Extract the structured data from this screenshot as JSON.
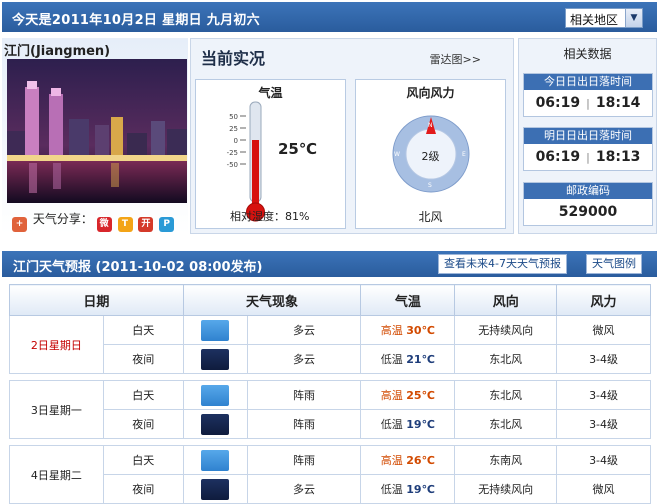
{
  "header": {
    "title": "今天是2011年10月2日  星期日  九月初六",
    "region_select": "相关地区"
  },
  "city": {
    "name": "江门(Jiangmen)",
    "share_label": "天气分享："
  },
  "current": {
    "title": "当前实况",
    "radar_link": "雷达图>>",
    "temp_label": "气温",
    "temp_value": "25℃",
    "scale": [
      "50",
      "25",
      "0",
      "-25",
      "-50"
    ],
    "humidity": "相对湿度：81%",
    "wind_title": "风向风力",
    "wind_level": "2级",
    "wind_dir": "北风",
    "compass": {
      "n": "N",
      "e": "E",
      "s": "S",
      "w": "W"
    }
  },
  "related": {
    "title": "相关数据",
    "today_label": "今日日出日落时间",
    "today_rise": "06:19",
    "today_set": "18:14",
    "tomorrow_label": "明日日出日落时间",
    "tomorrow_rise": "06:19",
    "tomorrow_set": "18:13",
    "sep": "|",
    "zip_label": "邮政编码",
    "zip": "529000"
  },
  "forecast": {
    "title": "江门天气预报  (2011-10-02  08:00发布)",
    "btn_more": "查看未来4-7天天气预报",
    "btn_legend": "天气图例",
    "headers": [
      "日期",
      "天气现象",
      "气温",
      "风向",
      "风力"
    ],
    "days": [
      {
        "date": "2日星期日",
        "day": {
          "period": "白天",
          "weather": "多云",
          "temp_label": "高温",
          "temp": "30℃",
          "wind_dir": "无持续风向",
          "wind": "微风"
        },
        "night": {
          "period": "夜间",
          "weather": "多云",
          "temp_label": "低温",
          "temp": "21℃",
          "wind_dir": "东北风",
          "wind": "3-4级"
        }
      },
      {
        "date": "3日星期一",
        "day": {
          "period": "白天",
          "weather": "阵雨",
          "temp_label": "高温",
          "temp": "25℃",
          "wind_dir": "东北风",
          "wind": "3-4级"
        },
        "night": {
          "period": "夜间",
          "weather": "阵雨",
          "temp_label": "低温",
          "temp": "19℃",
          "wind_dir": "东北风",
          "wind": "3-4级"
        }
      },
      {
        "date": "4日星期二",
        "day": {
          "period": "白天",
          "weather": "阵雨",
          "temp_label": "高温",
          "temp": "26℃",
          "wind_dir": "东南风",
          "wind": "3-4级"
        },
        "night": {
          "period": "夜间",
          "weather": "多云",
          "temp_label": "低温",
          "temp": "19℃",
          "wind_dir": "无持续风向",
          "wind": "微风"
        }
      }
    ]
  }
}
